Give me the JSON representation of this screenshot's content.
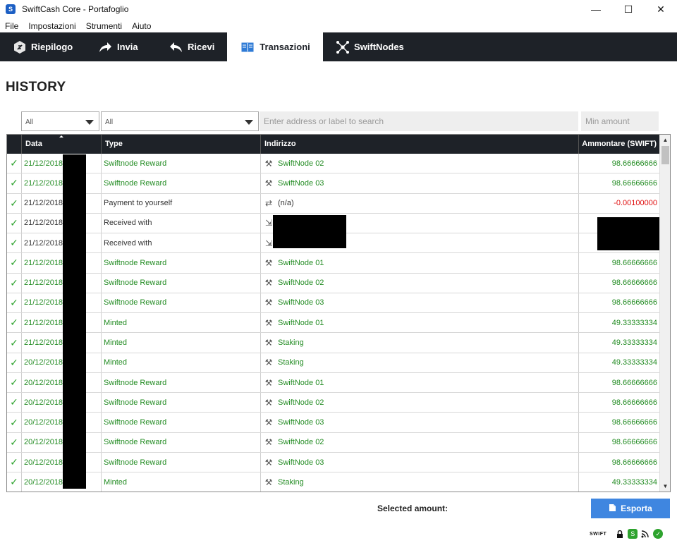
{
  "window": {
    "title": "SwiftCash Core - Portafoglio",
    "minimize": "—",
    "maximize": "☐",
    "close": "✕"
  },
  "menu": [
    "File",
    "Impostazioni",
    "Strumenti",
    "Aiuto"
  ],
  "tabs": [
    {
      "label": "Riepilogo",
      "icon": "overview-icon"
    },
    {
      "label": "Invia",
      "icon": "send-icon"
    },
    {
      "label": "Ricevi",
      "icon": "receive-icon"
    },
    {
      "label": "Transazioni",
      "icon": "transactions-icon",
      "active": true
    },
    {
      "label": "SwiftNodes",
      "icon": "nodes-icon"
    }
  ],
  "page_title": "HISTORY",
  "filters": {
    "date_filter": "All",
    "type_filter": "All",
    "search_placeholder": "Enter address or label to search",
    "min_amount_placeholder": "Min amount"
  },
  "columns": [
    "Data",
    "Type",
    "Indirizzo",
    "Ammontare (SWIFT)"
  ],
  "rows": [
    {
      "date": "21/12/2018",
      "type": "Swiftnode Reward",
      "address": "SwiftNode 02",
      "icon": "mining-icon",
      "amount": "98.66666666",
      "tone": "green"
    },
    {
      "date": "21/12/2018",
      "type": "Swiftnode Reward",
      "address": "SwiftNode 03",
      "icon": "mining-icon",
      "amount": "98.66666666",
      "tone": "green"
    },
    {
      "date": "21/12/2018",
      "type": "Payment to yourself",
      "address": "(n/a)",
      "icon": "self-icon",
      "amount": "-0.00100000",
      "tone": "dark",
      "amount_tone": "red"
    },
    {
      "date": "21/12/2018",
      "type": "Received with",
      "address": "",
      "icon": "receive-small-icon",
      "amount": "",
      "tone": "dark"
    },
    {
      "date": "21/12/2018",
      "type": "Received with",
      "address": "",
      "icon": "receive-small-icon",
      "amount": "",
      "tone": "dark"
    },
    {
      "date": "21/12/2018",
      "type": "Swiftnode Reward",
      "address": "SwiftNode 01",
      "icon": "mining-icon",
      "amount": "98.66666666",
      "tone": "green"
    },
    {
      "date": "21/12/2018",
      "type": "Swiftnode Reward",
      "address": "SwiftNode 02",
      "icon": "mining-icon",
      "amount": "98.66666666",
      "tone": "green"
    },
    {
      "date": "21/12/2018",
      "type": "Swiftnode Reward",
      "address": "SwiftNode 03",
      "icon": "mining-icon",
      "amount": "98.66666666",
      "tone": "green"
    },
    {
      "date": "21/12/2018",
      "type": "Minted",
      "address": "SwiftNode 01",
      "icon": "mining-icon",
      "amount": "49.33333334",
      "tone": "green"
    },
    {
      "date": "21/12/2018",
      "type": "Minted",
      "address": "Staking",
      "icon": "mining-icon",
      "amount": "49.33333334",
      "tone": "green"
    },
    {
      "date": "20/12/2018",
      "type": "Minted",
      "address": "Staking",
      "icon": "mining-icon",
      "amount": "49.33333334",
      "tone": "green"
    },
    {
      "date": "20/12/2018",
      "type": "Swiftnode Reward",
      "address": "SwiftNode 01",
      "icon": "mining-icon",
      "amount": "98.66666666",
      "tone": "green"
    },
    {
      "date": "20/12/2018",
      "type": "Swiftnode Reward",
      "address": "SwiftNode 02",
      "icon": "mining-icon",
      "amount": "98.66666666",
      "tone": "green"
    },
    {
      "date": "20/12/2018",
      "type": "Swiftnode Reward",
      "address": "SwiftNode 03",
      "icon": "mining-icon",
      "amount": "98.66666666",
      "tone": "green"
    },
    {
      "date": "20/12/2018",
      "type": "Swiftnode Reward",
      "address": "SwiftNode 02",
      "icon": "mining-icon",
      "amount": "98.66666666",
      "tone": "green"
    },
    {
      "date": "20/12/2018",
      "type": "Swiftnode Reward",
      "address": "SwiftNode 03",
      "icon": "mining-icon",
      "amount": "98.66666666",
      "tone": "green"
    },
    {
      "date": "20/12/2018",
      "type": "Minted",
      "address": "Staking",
      "icon": "mining-icon",
      "amount": "49.33333334",
      "tone": "green"
    }
  ],
  "footer": {
    "selected_amount_label": "Selected amount:",
    "export_label": "Esporta"
  },
  "status": {
    "logo_text": "SWIFT",
    "icons": [
      "lock-icon",
      "staking-icon",
      "network-icon",
      "sync-ok-icon"
    ]
  },
  "colors": {
    "accent": "#3f86e0",
    "tab_bar": "#1e2228",
    "positive": "#238c23",
    "negative": "#e01010",
    "confirmed": "#2ea32e"
  }
}
